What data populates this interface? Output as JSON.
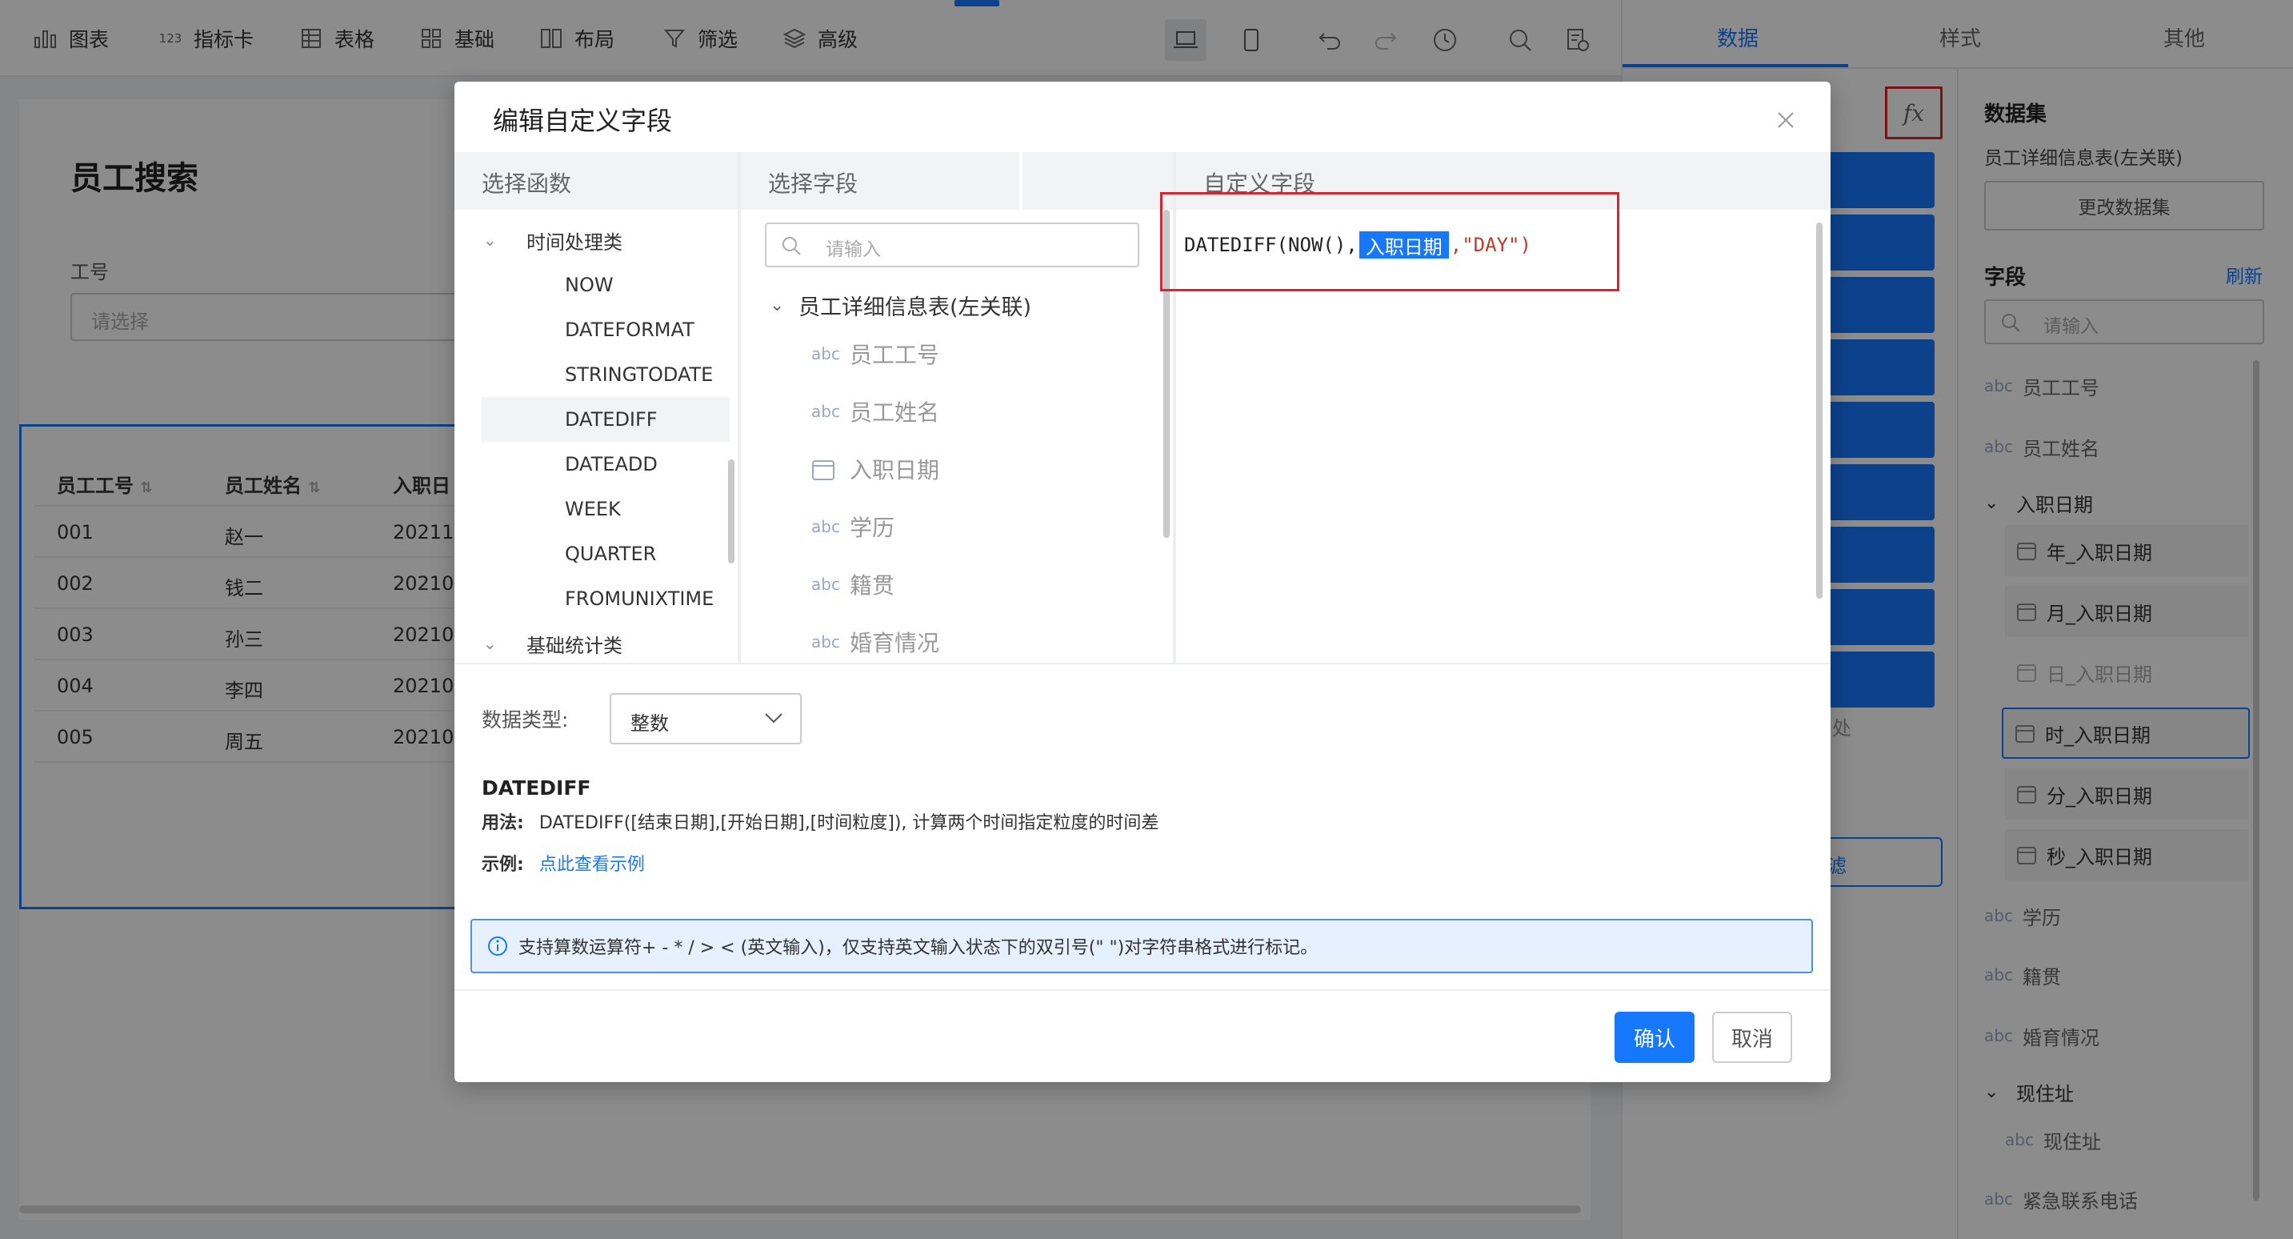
{
  "toolbar": {
    "items": [
      {
        "label": "图表",
        "icon": "bar-chart-icon"
      },
      {
        "label": "指标卡",
        "icon": "number-icon"
      },
      {
        "label": "表格",
        "icon": "table-icon"
      },
      {
        "label": "基础",
        "icon": "grid-icon"
      },
      {
        "label": "布局",
        "icon": "layout-icon"
      },
      {
        "label": "筛选",
        "icon": "filter-icon"
      },
      {
        "label": "高级",
        "icon": "layers-icon"
      }
    ],
    "number_glyph": "123"
  },
  "right_tabs": [
    "数据",
    "样式",
    "其他"
  ],
  "canvas": {
    "title": "员工搜索",
    "filter_label": "工号",
    "filter_placeholder": "请选择",
    "table": {
      "headers": [
        "员工工号",
        "员工姓名",
        "入职日"
      ],
      "rows": [
        [
          "001",
          "赵一",
          "20211("
        ],
        [
          "002",
          "钱二",
          "20210"
        ],
        [
          "003",
          "孙三",
          "20210"
        ],
        [
          "004",
          "李四",
          "20210"
        ],
        [
          "005",
          "周五",
          "20210"
        ]
      ]
    }
  },
  "middle_panel": {
    "partial_text_1": "处",
    "partial_text_2": "滤"
  },
  "dataset_panel": {
    "fx_label": "fx",
    "dataset_title": "数据集",
    "dataset_name": "员工详细信息表(左关联)",
    "change_button": "更改数据集",
    "fields_title": "字段",
    "refresh": "刷新",
    "search_placeholder": "请输入",
    "fields": [
      {
        "type": "abc",
        "label": "员工工号"
      },
      {
        "type": "abc",
        "label": "员工姓名"
      },
      {
        "type": "group",
        "label": "入职日期"
      },
      {
        "type": "date",
        "label": "年_入职日期"
      },
      {
        "type": "date",
        "label": "月_入职日期"
      },
      {
        "type": "date",
        "label": "日_入职日期"
      },
      {
        "type": "date",
        "label": "时_入职日期"
      },
      {
        "type": "date",
        "label": "分_入职日期"
      },
      {
        "type": "date",
        "label": "秒_入职日期"
      },
      {
        "type": "abc",
        "label": "学历"
      },
      {
        "type": "abc",
        "label": "籍贯"
      },
      {
        "type": "abc",
        "label": "婚育情况"
      },
      {
        "type": "group",
        "label": "现住址"
      },
      {
        "type": "abc",
        "label": "现住址"
      },
      {
        "type": "abc",
        "label": "紧急联系电话"
      }
    ]
  },
  "modal": {
    "title": "编辑自定义字段",
    "col_functions": "选择函数",
    "col_fields": "选择字段",
    "col_custom": "自定义字段",
    "function_groups": [
      {
        "label": "时间处理类",
        "items": [
          "NOW",
          "DATEFORMAT",
          "STRINGTODATE",
          "DATEDIFF",
          "DATEADD",
          "WEEK",
          "QUARTER",
          "FROMUNIXTIME"
        ]
      },
      {
        "label": "基础统计类",
        "items": []
      }
    ],
    "selected_function": "DATEDIFF",
    "field_search_placeholder": "请输入",
    "field_table": "员工详细信息表(左关联)",
    "field_items": [
      {
        "type": "abc",
        "label": "员工工号"
      },
      {
        "type": "abc",
        "label": "员工姓名"
      },
      {
        "type": "date",
        "label": "入职日期"
      },
      {
        "type": "abc",
        "label": "学历"
      },
      {
        "type": "abc",
        "label": "籍贯"
      },
      {
        "type": "abc",
        "label": "婚育情况"
      }
    ],
    "formula": {
      "prefix": "DATEDIFF(NOW(),",
      "chip": "入职日期",
      "suffix": ",\"DAY\")"
    },
    "data_type_label": "数据类型:",
    "data_type_value": "整数",
    "fn_name": "DATEDIFF",
    "usage_label": "用法:",
    "usage_text": "DATEDIFF([结束日期],[开始日期],[时间粒度]), 计算两个时间指定粒度的时间差",
    "example_label": "示例:",
    "example_link": "点此查看示例",
    "info_text": "支持算数运算符+ - * / > < (英文输入)，仅支持英文输入状态下的双引号(\" \")对字符串格式进行标记。",
    "confirm": "确认",
    "cancel": "取消"
  },
  "colors": {
    "accent": "#1677ff",
    "highlight": "#d9232d",
    "chip": "#1677ff"
  }
}
